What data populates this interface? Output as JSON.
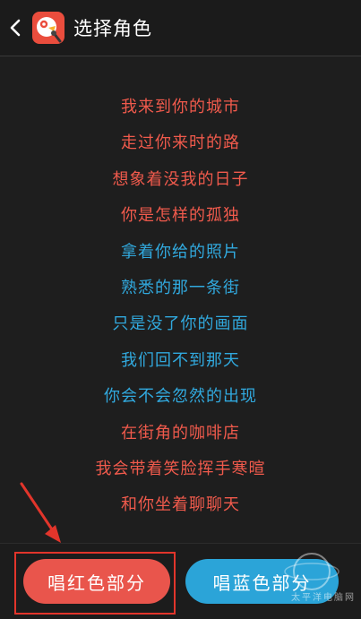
{
  "header": {
    "title": "选择角色",
    "back_icon": "chevron-left-icon",
    "app_icon": "bird-mic-app-icon"
  },
  "lyrics": [
    {
      "text": "我来到你的城市",
      "part": "red"
    },
    {
      "text": "走过你来时的路",
      "part": "red"
    },
    {
      "text": "想象着没我的日子",
      "part": "red"
    },
    {
      "text": "你是怎样的孤独",
      "part": "red"
    },
    {
      "text": "拿着你给的照片",
      "part": "blue"
    },
    {
      "text": "熟悉的那一条街",
      "part": "blue"
    },
    {
      "text": "只是没了你的画面",
      "part": "blue"
    },
    {
      "text": "我们回不到那天",
      "part": "blue"
    },
    {
      "text": "你会不会忽然的出现",
      "part": "blue"
    },
    {
      "text": "在街角的咖啡店",
      "part": "red"
    },
    {
      "text": "我会带着笑脸挥手寒暄",
      "part": "red"
    },
    {
      "text": "和你坐着聊聊天",
      "part": "red"
    }
  ],
  "colors": {
    "red": "#f05a4c",
    "blue": "#31a9de",
    "accent_box": "#e2352b"
  },
  "buttons": {
    "sing_red": "唱红色部分",
    "sing_blue": "唱蓝色部分"
  },
  "watermark": {
    "text": "太平洋电脑网"
  }
}
